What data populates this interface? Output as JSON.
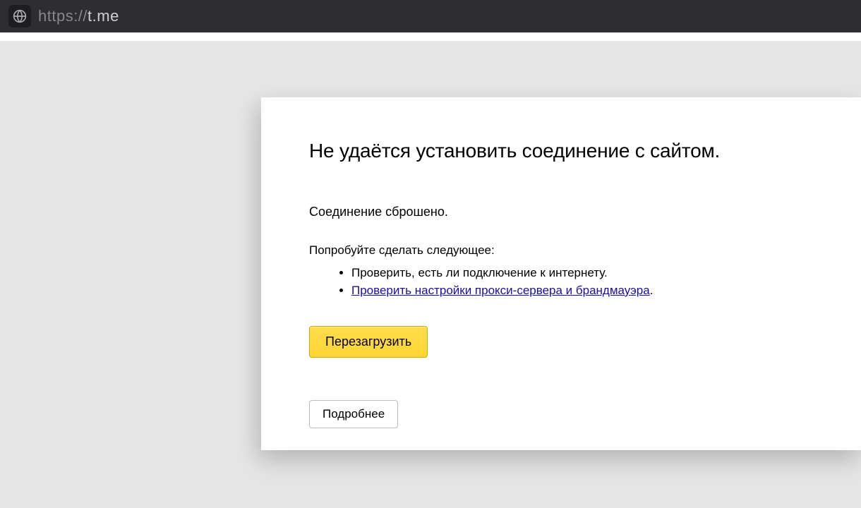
{
  "address": {
    "scheme": "https://",
    "host": "t.me"
  },
  "error": {
    "title": "Не удаётся установить соединение с сайтом.",
    "subtitle": "Соединение сброшено.",
    "instructions": "Попробуйте сделать следующее:",
    "list": {
      "item1": "Проверить, есть ли подключение к интернету.",
      "item2_link": "Проверить настройки прокси-сервера и брандмауэра",
      "item2_suffix": "."
    },
    "reload_label": "Перезагрузить",
    "details_label": "Подробнее"
  }
}
